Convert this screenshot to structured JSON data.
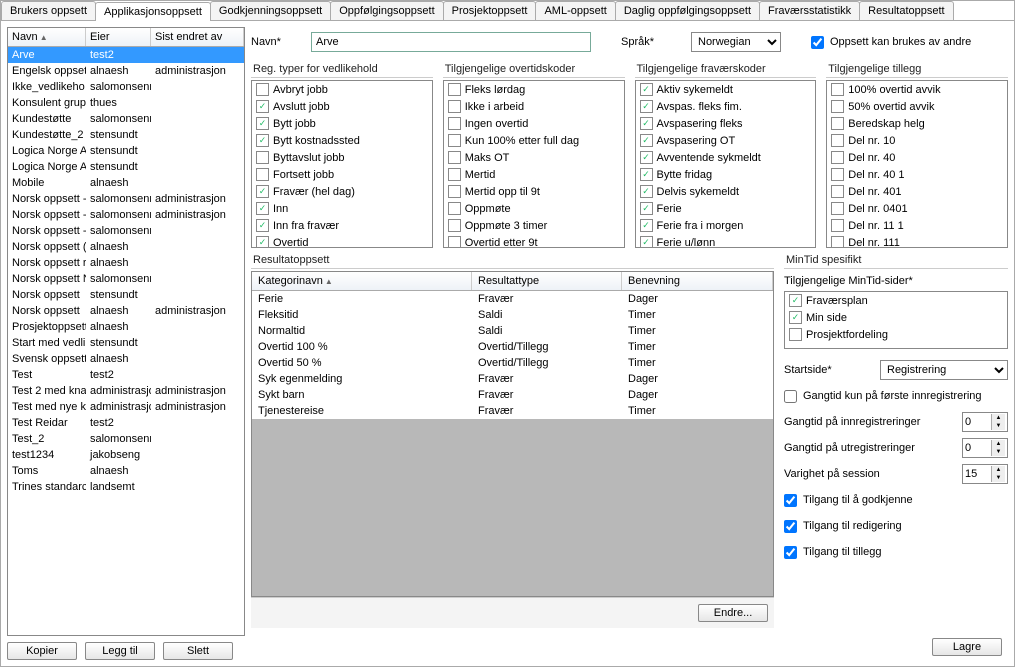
{
  "tabs": [
    "Brukers oppsett",
    "Applikasjonsoppsett",
    "Godkjenningsoppsett",
    "Oppfølgingsoppsett",
    "Prosjektoppsett",
    "AML-oppsett",
    "Daglig oppfølgingsoppsett",
    "Fraværsstatistikk",
    "Resultatoppsett"
  ],
  "activeTab": 1,
  "leftTable": {
    "headers": {
      "navn": "Navn",
      "eier": "Eier",
      "sist": "Sist endret av"
    },
    "rows": [
      {
        "navn": "Arve",
        "eier": "test2",
        "sist": ""
      },
      {
        "navn": "Engelsk oppset",
        "eier": "alnaesh",
        "sist": "administrasjon"
      },
      {
        "navn": "Ikke_vedlikeho",
        "eier": "salomonsenr",
        "sist": ""
      },
      {
        "navn": "Konsulent grupp",
        "eier": "thues",
        "sist": ""
      },
      {
        "navn": "Kundestøtte",
        "eier": "salomonsenr",
        "sist": ""
      },
      {
        "navn": "Kundestøtte_2",
        "eier": "stensundt",
        "sist": ""
      },
      {
        "navn": "Logica Norge A",
        "eier": "stensundt",
        "sist": ""
      },
      {
        "navn": "Logica Norge A",
        "eier": "stensundt",
        "sist": ""
      },
      {
        "navn": "Mobile",
        "eier": "alnaesh",
        "sist": ""
      },
      {
        "navn": "Norsk oppsett -",
        "eier": "salomonsenr",
        "sist": "administrasjon"
      },
      {
        "navn": "Norsk oppsett -",
        "eier": "salomonsenr",
        "sist": "administrasjon"
      },
      {
        "navn": "Norsk oppsett -",
        "eier": "salomonsenr",
        "sist": ""
      },
      {
        "navn": "Norsk oppsett (",
        "eier": "alnaesh",
        "sist": ""
      },
      {
        "navn": "Norsk oppsett r",
        "eier": "alnaesh",
        "sist": ""
      },
      {
        "navn": "Norsk oppsett N",
        "eier": "salomonsenr",
        "sist": ""
      },
      {
        "navn": "Norsk oppsett",
        "eier": "stensundt",
        "sist": ""
      },
      {
        "navn": "Norsk oppsett",
        "eier": "alnaesh",
        "sist": "administrasjon"
      },
      {
        "navn": "Prosjektoppsett",
        "eier": "alnaesh",
        "sist": ""
      },
      {
        "navn": "Start med vedlik",
        "eier": "stensundt",
        "sist": ""
      },
      {
        "navn": "Svensk oppsett",
        "eier": "alnaesh",
        "sist": ""
      },
      {
        "navn": "Test",
        "eier": "test2",
        "sist": ""
      },
      {
        "navn": "Test 2 med kna",
        "eier": "administrasjo",
        "sist": "administrasjon"
      },
      {
        "navn": "Test med nye k",
        "eier": "administrasjo",
        "sist": "administrasjon"
      },
      {
        "navn": "Test Reidar",
        "eier": "test2",
        "sist": ""
      },
      {
        "navn": "Test_2",
        "eier": "salomonsenr",
        "sist": ""
      },
      {
        "navn": "test1234",
        "eier": "jakobseng",
        "sist": ""
      },
      {
        "navn": "Toms",
        "eier": "alnaesh",
        "sist": ""
      },
      {
        "navn": "Trines standarc",
        "eier": "landsemt",
        "sist": ""
      }
    ],
    "selected": 0
  },
  "leftButtons": {
    "kopier": "Kopier",
    "leggtil": "Legg til",
    "slett": "Slett"
  },
  "form": {
    "navn_label": "Navn*",
    "navn_value": "Arve",
    "sprak_label": "Språk*",
    "sprak_value": "Norwegian",
    "shared_label": "Oppsett kan brukes av andre",
    "shared_checked": true
  },
  "lists": {
    "reg": {
      "title": "Reg. typer for vedlikehold",
      "items": [
        {
          "c": false,
          "t": "Avbryt jobb"
        },
        {
          "c": true,
          "t": "Avslutt jobb"
        },
        {
          "c": true,
          "t": "Bytt jobb"
        },
        {
          "c": true,
          "t": "Bytt kostnadssted"
        },
        {
          "c": false,
          "t": "Byttavslut jobb"
        },
        {
          "c": false,
          "t": "Fortsett jobb"
        },
        {
          "c": true,
          "t": "Fravær (hel dag)"
        },
        {
          "c": true,
          "t": "Inn"
        },
        {
          "c": true,
          "t": "Inn fra fravær"
        },
        {
          "c": true,
          "t": "Overtid"
        }
      ]
    },
    "overtid": {
      "title": "Tilgjengelige overtidskoder",
      "items": [
        {
          "c": false,
          "t": "Fleks lørdag"
        },
        {
          "c": false,
          "t": "Ikke i arbeid"
        },
        {
          "c": false,
          "t": "Ingen overtid"
        },
        {
          "c": false,
          "t": "Kun 100% etter full dag"
        },
        {
          "c": false,
          "t": "Maks OT"
        },
        {
          "c": false,
          "t": "Mertid"
        },
        {
          "c": false,
          "t": "Mertid opp til 9t"
        },
        {
          "c": false,
          "t": "Oppmøte"
        },
        {
          "c": false,
          "t": "Oppmøte 3 timer"
        },
        {
          "c": false,
          "t": "Overtid etter 9t"
        }
      ]
    },
    "fravaer": {
      "title": "Tilgjengelige fraværskoder",
      "items": [
        {
          "c": true,
          "t": "Aktiv sykemeldt"
        },
        {
          "c": true,
          "t": "Avspas. fleks fim."
        },
        {
          "c": true,
          "t": "Avspasering fleks"
        },
        {
          "c": true,
          "t": "Avspasering OT"
        },
        {
          "c": true,
          "t": "Avventende sykmeldt"
        },
        {
          "c": true,
          "t": "Bytte fridag"
        },
        {
          "c": true,
          "t": "Delvis sykemeldt"
        },
        {
          "c": true,
          "t": "Ferie"
        },
        {
          "c": true,
          "t": "Ferie fra i morgen"
        },
        {
          "c": true,
          "t": "Ferie u/lønn"
        }
      ]
    },
    "tillegg": {
      "title": "Tilgjengelige tillegg",
      "items": [
        {
          "c": false,
          "t": "100% overtid avvik"
        },
        {
          "c": false,
          "t": "50% overtid avvik"
        },
        {
          "c": false,
          "t": "Beredskap helg"
        },
        {
          "c": false,
          "t": "Del nr. 10"
        },
        {
          "c": false,
          "t": "Del nr. 40"
        },
        {
          "c": false,
          "t": "Del nr. 40 1"
        },
        {
          "c": false,
          "t": "Del nr. 401"
        },
        {
          "c": false,
          "t": "Del nr. 0401"
        },
        {
          "c": false,
          "t": "Del nr. 11 1"
        },
        {
          "c": false,
          "t": "Del nr. 111"
        }
      ]
    }
  },
  "result": {
    "title": "Resultatoppsett",
    "headers": {
      "kat": "Kategorinavn",
      "type": "Resultattype",
      "ben": "Benevning"
    },
    "rows": [
      {
        "k": "Ferie",
        "t": "Fravær",
        "b": "Dager"
      },
      {
        "k": "Fleksitid",
        "t": "Saldi",
        "b": "Timer"
      },
      {
        "k": "Normaltid",
        "t": "Saldi",
        "b": "Timer"
      },
      {
        "k": "Overtid 100 %",
        "t": "Overtid/Tillegg",
        "b": "Timer"
      },
      {
        "k": "Overtid 50 %",
        "t": "Overtid/Tillegg",
        "b": "Timer"
      },
      {
        "k": "Syk egenmelding",
        "t": "Fravær",
        "b": "Dager"
      },
      {
        "k": "Sykt barn",
        "t": "Fravær",
        "b": "Dager"
      },
      {
        "k": "Tjenestereise",
        "t": "Fravær",
        "b": "Timer"
      }
    ],
    "endre": "Endre..."
  },
  "mintid": {
    "title": "MinTid spesifikt",
    "sider_label": "Tilgjengelige MinTid-sider*",
    "sider": [
      {
        "c": true,
        "t": "Fraværsplan"
      },
      {
        "c": true,
        "t": "Min side"
      },
      {
        "c": false,
        "t": "Prosjektfordeling"
      }
    ],
    "startside_label": "Startside*",
    "startside_value": "Registrering",
    "gangtid_forste": "Gangtid kun på første innregistrering",
    "gangtid_inn_label": "Gangtid på innregistreringer",
    "gangtid_inn": "0",
    "gangtid_ut_label": "Gangtid på utregistreringer",
    "gangtid_ut": "0",
    "varighet_label": "Varighet på session",
    "varighet": "15",
    "tilgang_godk": "Tilgang til å godkjenne",
    "tilgang_red": "Tilgang til redigering",
    "tilgang_til": "Tilgang til tillegg"
  },
  "lagre": "Lagre"
}
